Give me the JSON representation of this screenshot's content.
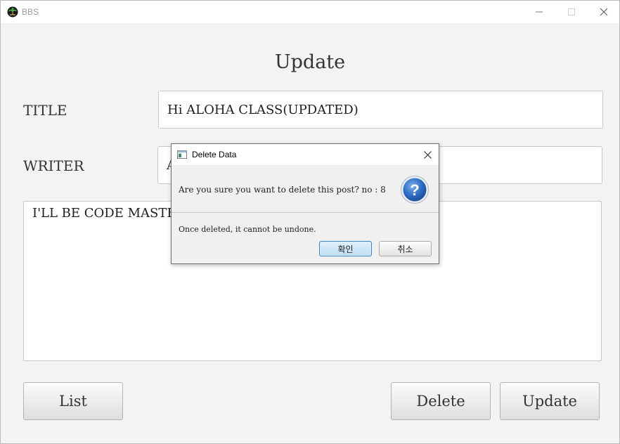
{
  "window": {
    "title": "BBS",
    "icon": "palm-tree-icon"
  },
  "form": {
    "heading": "Update",
    "title_label": "TITLE",
    "title_value": "Hi ALOHA CLASS(UPDATED)",
    "writer_label": "WRITER",
    "writer_value": "A",
    "content_value": "I'LL BE CODE MASTER"
  },
  "buttons": {
    "list": "List",
    "delete": "Delete",
    "update": "Update"
  },
  "dialog": {
    "title": "Delete Data",
    "question": "Are you sure you want to delete this post? no : 8",
    "content": "Once deleted, it cannot be undone.",
    "ok_label": "확인",
    "cancel_label": "취소",
    "icon": "question-icon"
  },
  "colors": {
    "background": "#f3f3f3",
    "dialog_ok_accent": "#3a86c8",
    "question_icon": "#2f6fc6"
  }
}
